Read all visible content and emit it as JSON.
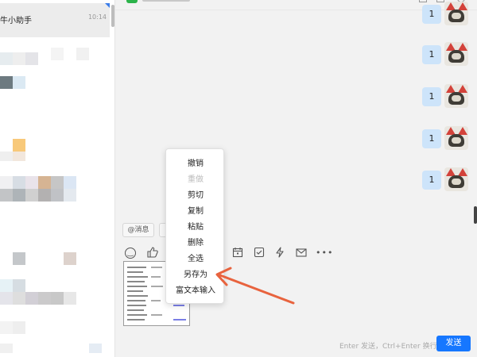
{
  "sidebar": {
    "active_conversation": {
      "name": "牛小助手",
      "time": "10:14"
    }
  },
  "chat": {
    "messages": [
      {
        "text": "1",
        "avatar": "panda-avatar-icon"
      },
      {
        "text": "1",
        "avatar": "panda-avatar-icon"
      },
      {
        "text": "1",
        "avatar": "panda-avatar-icon"
      },
      {
        "text": "1",
        "avatar": "panda-avatar-icon"
      },
      {
        "text": "1",
        "avatar": "panda-avatar-icon"
      }
    ]
  },
  "composer": {
    "chips": [
      "@消息"
    ],
    "toolbar_icons": [
      "emoji-icon",
      "like-icon",
      "calendar-icon",
      "check-icon",
      "bolt-icon",
      "mail-icon",
      "more-icon"
    ],
    "send_hint": "Enter 发送，Ctrl+Enter 换行",
    "send_label": "发送"
  },
  "context_menu": {
    "items": [
      {
        "label": "撤销",
        "enabled": true
      },
      {
        "label": "重做",
        "enabled": false
      },
      {
        "label": "剪切",
        "enabled": true
      },
      {
        "label": "复制",
        "enabled": true
      },
      {
        "label": "粘贴",
        "enabled": true
      },
      {
        "label": "删除",
        "enabled": true
      },
      {
        "label": "全选",
        "enabled": true
      },
      {
        "label": "另存为",
        "enabled": true
      },
      {
        "label": "富文本输入",
        "enabled": true
      }
    ]
  },
  "colors": {
    "accent": "#1677ff",
    "bubble": "#cde4fa",
    "annotation_arrow": "#e8633e"
  }
}
